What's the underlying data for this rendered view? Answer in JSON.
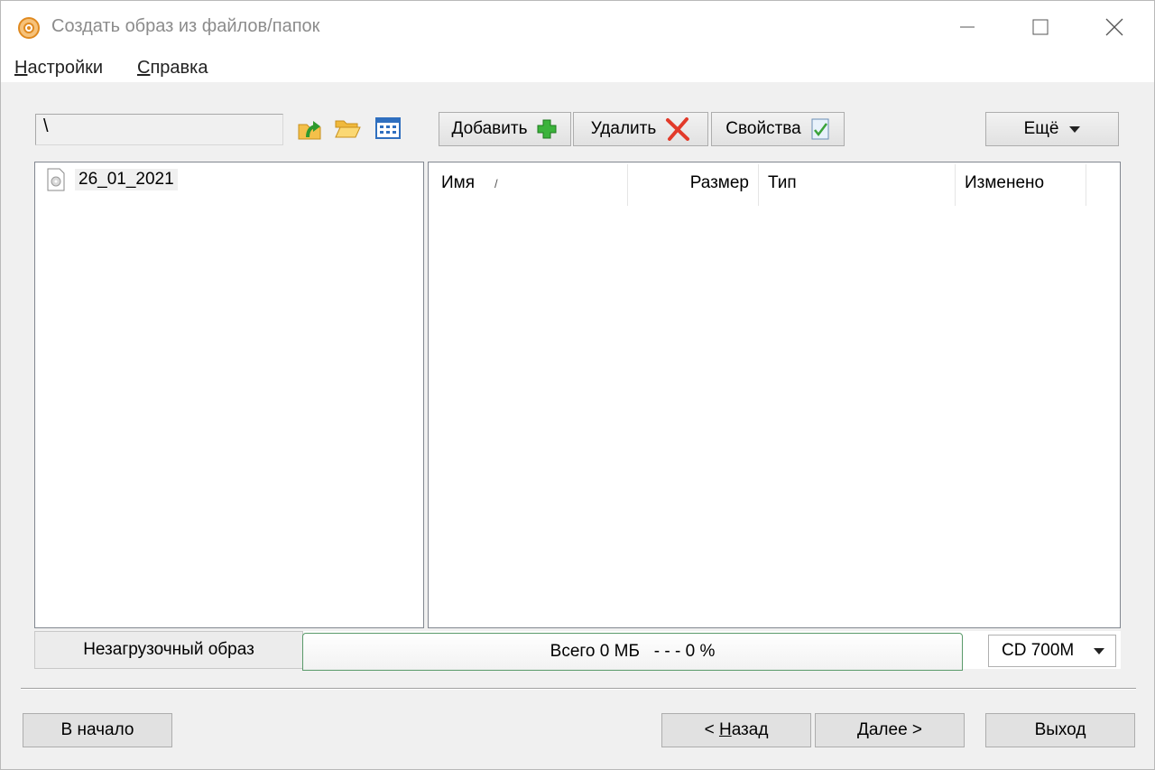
{
  "window": {
    "title": "Создать образ из файлов/папок",
    "controls": {
      "minimize": "minimize-icon",
      "maximize": "maximize-icon",
      "close": "close-icon"
    }
  },
  "menu": {
    "settings": {
      "accel": "Н",
      "rest": "астройки"
    },
    "help": {
      "accel": "С",
      "rest": "правка"
    }
  },
  "toolbar": {
    "path_value": "\\",
    "icons": [
      "up-folder-icon",
      "open-folder-icon",
      "view-mode-icon"
    ],
    "add_label": "Добавить",
    "delete_label": "Удалить",
    "properties_label": "Свойства",
    "more_label": "Ещё"
  },
  "tree": {
    "items": [
      {
        "label": "26_01_2021",
        "icon": "disc-image-icon"
      }
    ]
  },
  "file_list": {
    "columns": [
      {
        "label": "Имя",
        "sort": "/"
      },
      {
        "label": "Размер"
      },
      {
        "label": "Тип"
      },
      {
        "label": "Изменено"
      }
    ],
    "rows": []
  },
  "status": {
    "boot_type": "Незагрузочный образ",
    "total_prefix": "Всего",
    "total_size": "0 МБ",
    "total_bar": "- - -",
    "total_percent": "0 %",
    "media": "CD 700M"
  },
  "nav": {
    "home_label": "В начало",
    "back": {
      "pre": "< ",
      "accel": "Н",
      "rest": "азад"
    },
    "next": {
      "accel": "Д",
      "rest": "алее >"
    },
    "exit_label": "Выход"
  },
  "colors": {
    "accent_add": "#3bb33b",
    "accent_delete": "#e23a2a",
    "title_icon": "#f0a030",
    "status_border": "#5a9a6a"
  }
}
